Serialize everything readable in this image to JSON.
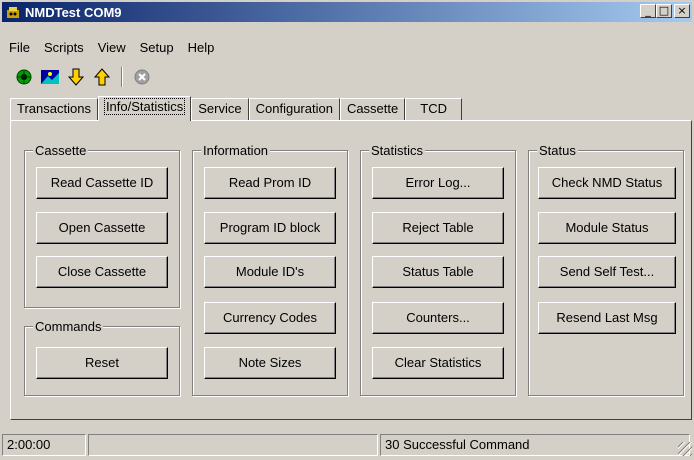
{
  "window": {
    "title": "NMDTest COM9"
  },
  "title_controls": {
    "minimize": "_",
    "maximize": "□",
    "close": "×"
  },
  "menu": [
    {
      "label": "File"
    },
    {
      "label": "Scripts"
    },
    {
      "label": "View"
    },
    {
      "label": "Setup"
    },
    {
      "label": "Help"
    }
  ],
  "toolbar": {
    "icons": [
      "connect-icon",
      "status-display-icon",
      "download-icon",
      "upload-icon",
      "stop-icon"
    ]
  },
  "tabs": [
    {
      "label": "Transactions",
      "active": false
    },
    {
      "label": "Info/Statistics",
      "active": true
    },
    {
      "label": "Service",
      "active": false
    },
    {
      "label": "Configuration",
      "active": false
    },
    {
      "label": "Cassette",
      "active": false
    },
    {
      "label": "TCD",
      "active": false
    }
  ],
  "groups": {
    "cassette": {
      "title": "Cassette",
      "buttons": [
        "Read Cassette ID",
        "Open Cassette",
        "Close Cassette"
      ]
    },
    "commands": {
      "title": "Commands",
      "buttons": [
        "Reset"
      ]
    },
    "information": {
      "title": "Information",
      "buttons": [
        "Read Prom ID",
        "Program ID block",
        "Module ID's",
        "Currency Codes",
        "Note Sizes"
      ]
    },
    "statistics": {
      "title": "Statistics",
      "buttons": [
        "Error Log...",
        "Reject Table",
        "Status Table",
        "Counters...",
        "Clear Statistics"
      ]
    },
    "status": {
      "title": "Status",
      "buttons": [
        "Check NMD Status",
        "Module Status",
        "Send Self Test...",
        "Resend Last Msg"
      ]
    }
  },
  "statusbar": {
    "time": "2:00:00",
    "middle": "",
    "message": "30 Successful Command"
  },
  "colors": {
    "title_start": "#0a246a",
    "title_end": "#a6caf0",
    "face": "#d4d0c8"
  }
}
